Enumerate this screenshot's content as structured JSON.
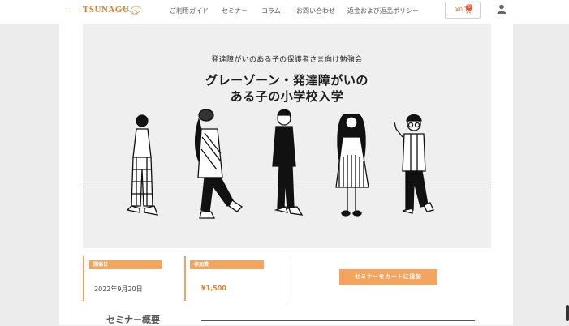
{
  "header": {
    "logo_text": "TSUNAGU",
    "nav": [
      "ご利用ガイド",
      "セミナー",
      "コラム",
      "お問い合わせ",
      "返金および返品ポリシー"
    ],
    "cart_amount": "¥0",
    "cart_count": "0",
    "icons": {
      "cart": "cart-icon",
      "user": "user-icon"
    }
  },
  "hero": {
    "subtitle": "発達障がいのある子の保護者さま向け勉強会",
    "title_line1": "グレーゾーン・発達障がいの",
    "title_line2": "ある子の小学校入学"
  },
  "info": {
    "date_tag": "開催日",
    "date_value": "2022年9月20日",
    "fee_tag": "参加費",
    "fee_value": "¥1,500",
    "cta_label": "セミナーをカートに追加"
  },
  "section": {
    "title": "セミナー概要"
  },
  "colors": {
    "accent": "#f3a560",
    "price": "#e0822e",
    "logo": "#d9822b"
  }
}
